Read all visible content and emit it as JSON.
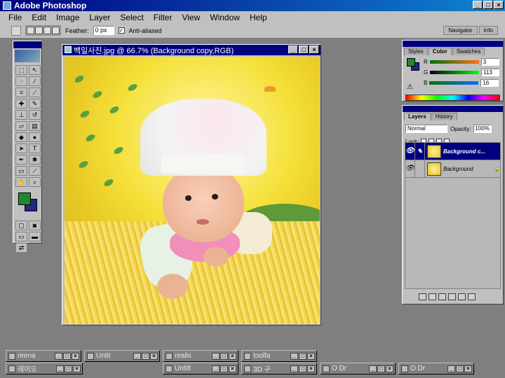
{
  "app": {
    "title": "Adobe Photoshop",
    "window_buttons": [
      "_",
      "□",
      "×"
    ]
  },
  "menu": [
    "File",
    "Edit",
    "Image",
    "Layer",
    "Select",
    "Filter",
    "View",
    "Window",
    "Help"
  ],
  "options_bar": {
    "feather_label": "Feather:",
    "feather_value": "0 px",
    "antialiased_label": "Anti-aliased",
    "antialiased_checked": true
  },
  "palette_well": {
    "tabs": [
      "Navigator",
      "Info"
    ]
  },
  "toolbox": {
    "tools": [
      "marquee",
      "move",
      "lasso",
      "magic-wand",
      "crop",
      "slice",
      "healing",
      "brush",
      "stamp",
      "history-brush",
      "eraser",
      "gradient",
      "blur",
      "dodge",
      "path-select",
      "type",
      "pen",
      "shape",
      "notes",
      "eyedropper",
      "hand",
      "zoom"
    ],
    "type_glyph": "T",
    "foreground_color": "#1e8a2e",
    "background_color": "#202a80"
  },
  "document": {
    "title": "백일사진.jpg @ 66.7% (Background copy,RGB)",
    "buttons": [
      "_",
      "□",
      "×"
    ]
  },
  "color_panel": {
    "tabs": [
      "Styles",
      "Color",
      "Swatches"
    ],
    "active_tab": "Color",
    "channels": [
      {
        "label": "R",
        "value": "3"
      },
      {
        "label": "G",
        "value": "113"
      },
      {
        "label": "B",
        "value": "16"
      }
    ],
    "warning_glyph": "⚠"
  },
  "layers_panel": {
    "tabs": [
      "Layers",
      "History"
    ],
    "active_tab": "Layers",
    "blend_mode": "Normal",
    "opacity_label": "Opacity:",
    "opacity_value": "100%",
    "lock_label": "Lock:",
    "layers": [
      {
        "name": "Background c...",
        "active": true,
        "visible": true,
        "locked": false
      },
      {
        "name": "Background",
        "active": false,
        "visible": true,
        "locked": true
      }
    ]
  },
  "minimized_windows": [
    {
      "title": "reena",
      "row": 1
    },
    {
      "title": "Untit",
      "row": 1
    },
    {
      "title": "realis",
      "row": 1
    },
    {
      "title": "toolfa",
      "row": 1
    },
    {
      "title": "레이오",
      "row": 2
    },
    {
      "title": "Untitl",
      "row": 2
    },
    {
      "title": "3D 구",
      "row": 2
    },
    {
      "title": "O Dr",
      "row": 2
    },
    {
      "title": "O Dr",
      "row": 2
    }
  ]
}
